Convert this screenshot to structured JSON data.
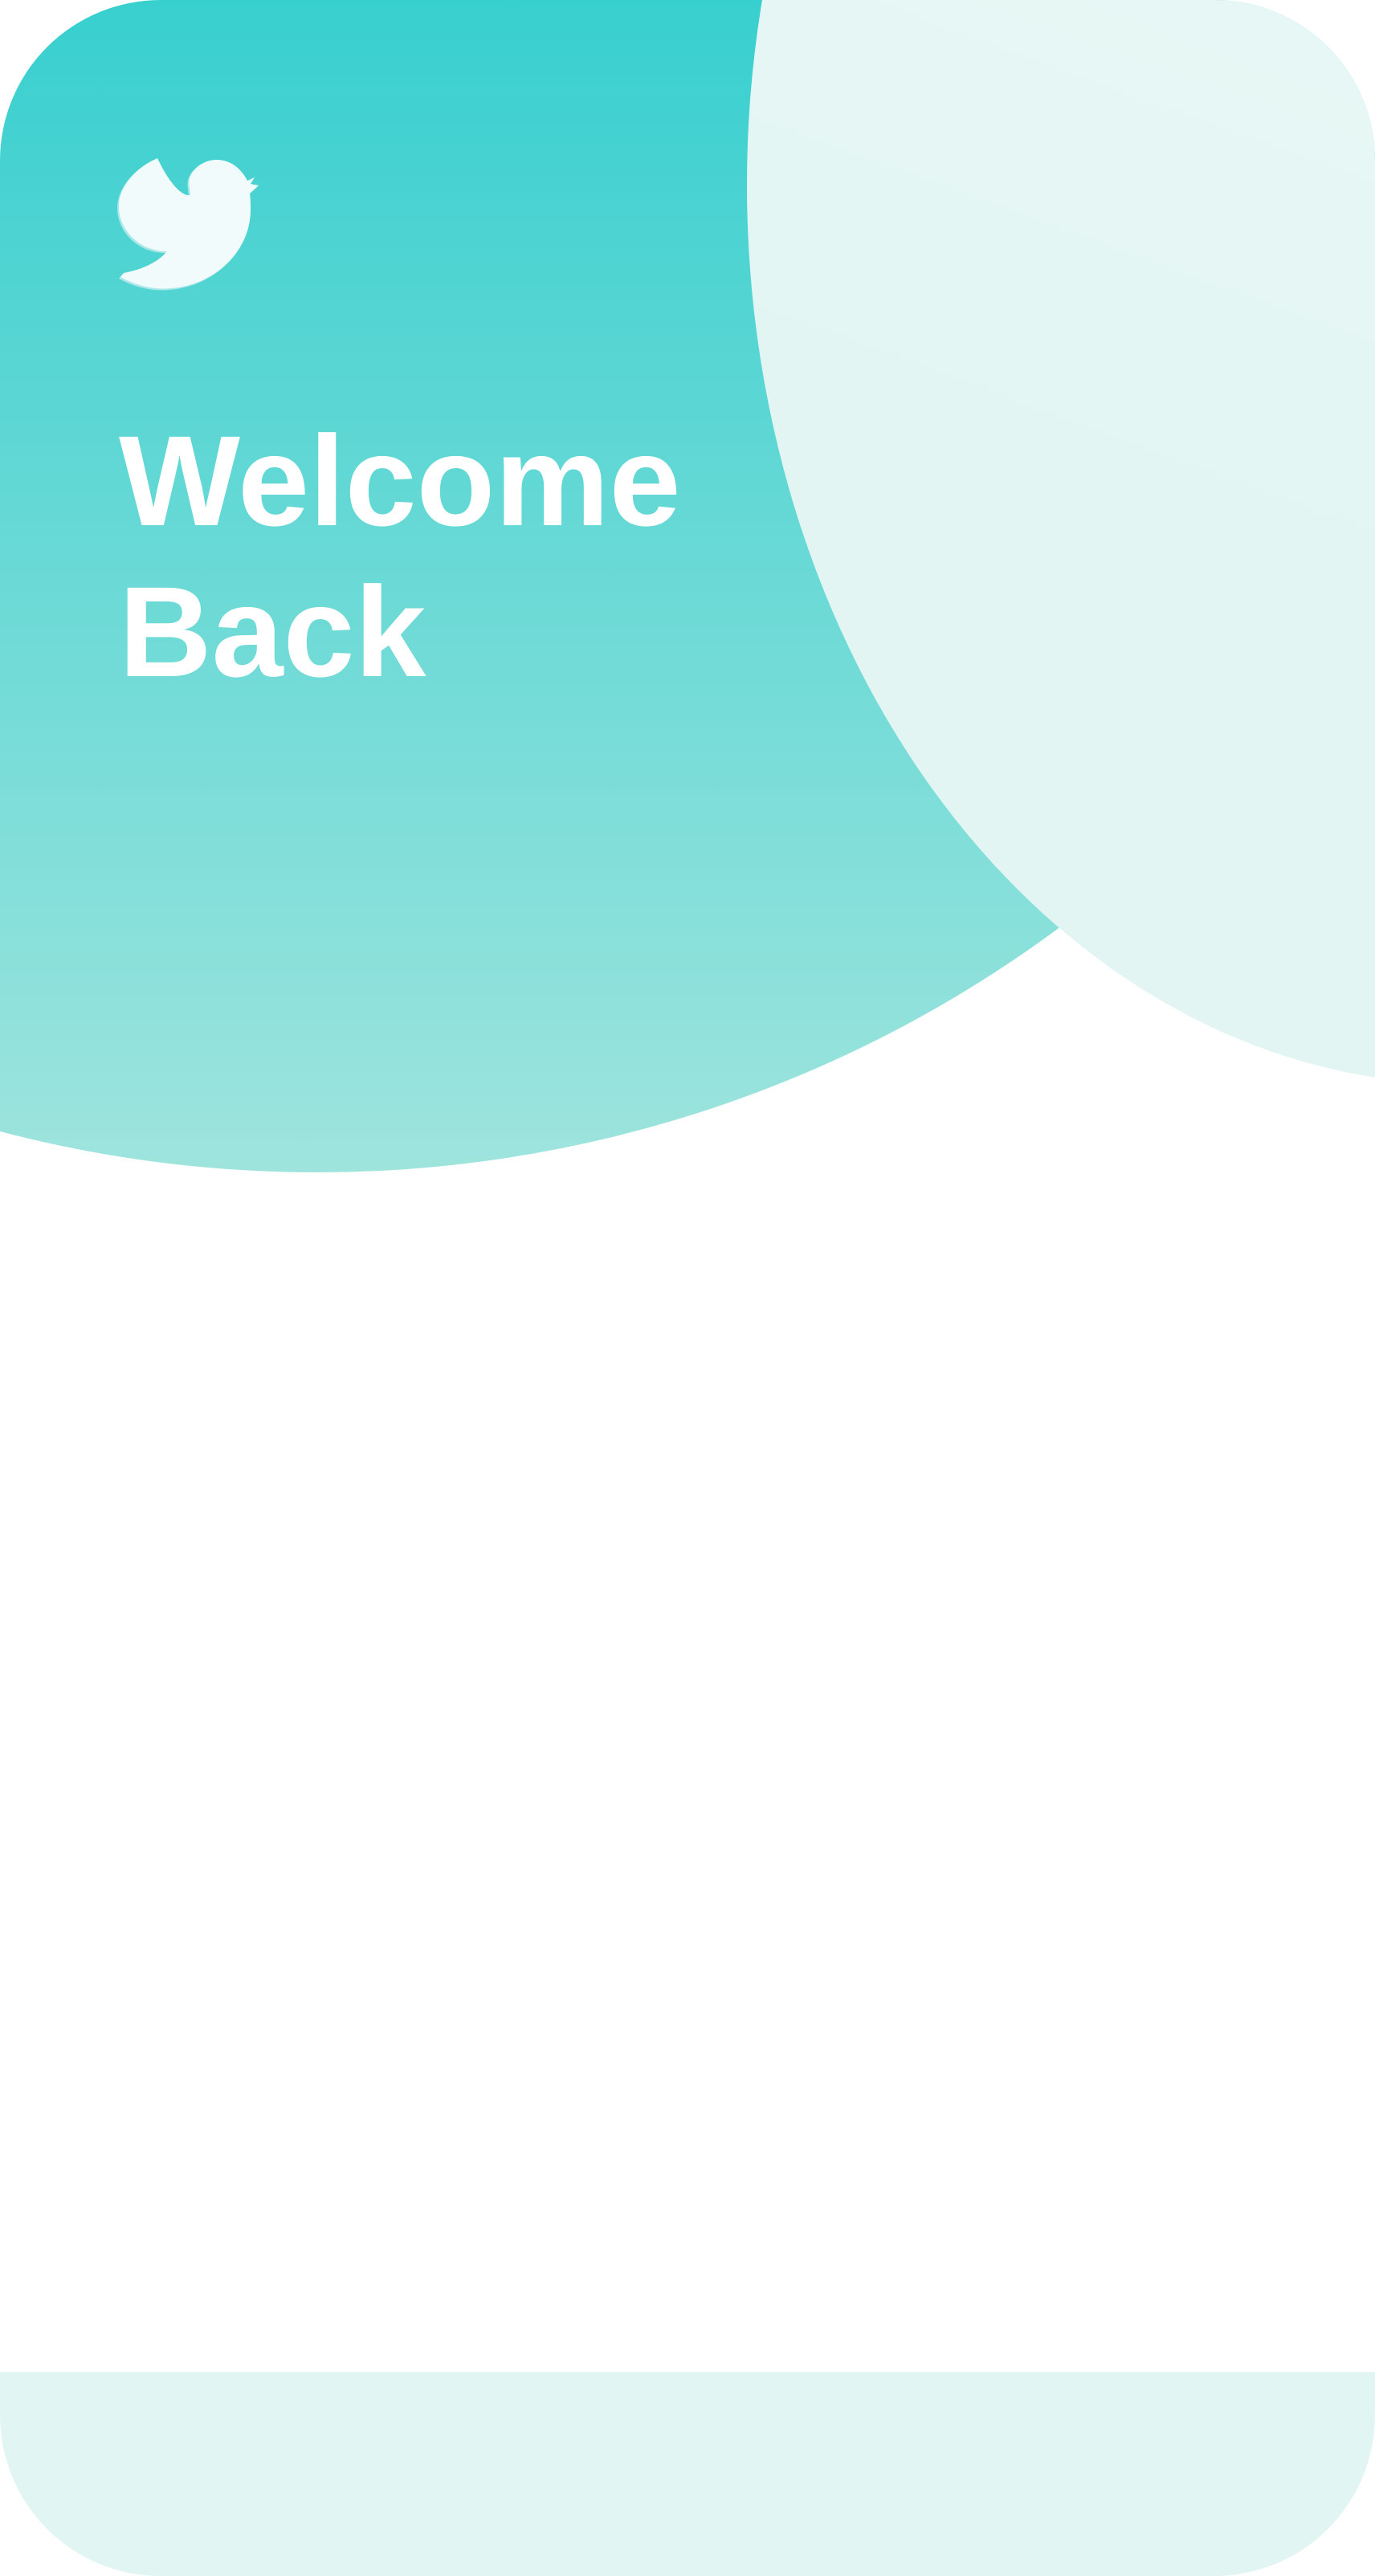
{
  "app": {
    "heading_line1": "Welcome",
    "heading_line2": "Back",
    "logo_icon": "bird-logo-icon"
  },
  "colors": {
    "teal_top": "#37cfcf",
    "teal_bottom": "#9ee4dd",
    "mint_light": "#effaf9",
    "mint_band": "#e1f5f2",
    "text": "#ffffff"
  }
}
